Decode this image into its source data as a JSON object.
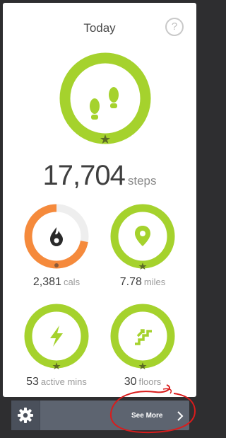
{
  "header": {
    "title": "Today",
    "help_glyph": "?"
  },
  "steps": {
    "value": "17,704",
    "unit": "steps",
    "progress": 1.0,
    "icon": "footprints-icon"
  },
  "stats": [
    {
      "id": "calories",
      "value": "2,381",
      "unit": "cals",
      "progress": 0.72,
      "icon": "flame-icon",
      "color": "#f58a3c"
    },
    {
      "id": "distance",
      "value": "7.78",
      "unit": "miles",
      "progress": 1.0,
      "icon": "location-pin-icon",
      "color": "#a5d22d"
    },
    {
      "id": "active",
      "value": "53",
      "unit": "active mins",
      "progress": 1.0,
      "icon": "lightning-icon",
      "color": "#a5d22d"
    },
    {
      "id": "floors",
      "value": "30",
      "unit": "floors",
      "progress": 1.0,
      "icon": "stairs-icon",
      "color": "#a5d22d"
    }
  ],
  "footer": {
    "see_more_label": "See More",
    "settings_icon": "gear-icon"
  },
  "colors": {
    "goal_green": "#a5d22d",
    "calories_orange": "#f58a3c",
    "track_gray": "#eeeeee",
    "bar": "#5d6470",
    "annotation_red": "#d91c1c"
  }
}
